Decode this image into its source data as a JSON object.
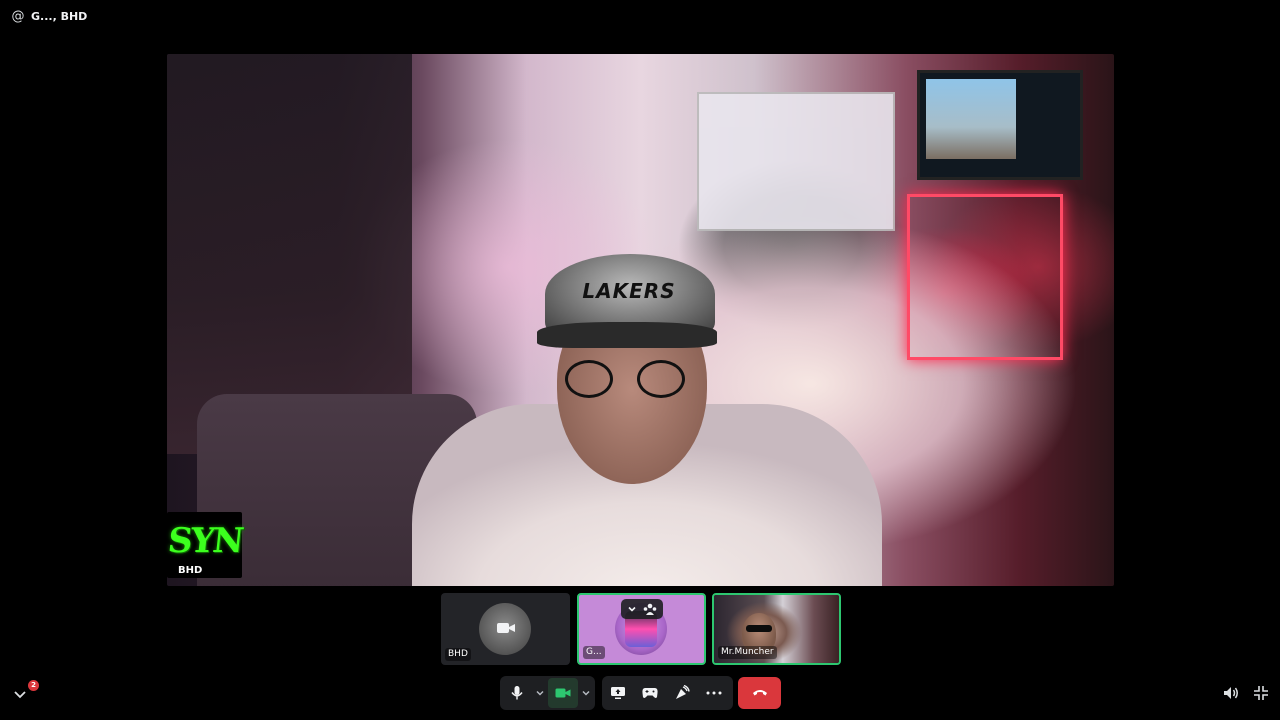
{
  "header": {
    "at_symbol": "@",
    "title": "G..., BHD"
  },
  "main_stream": {
    "overlay_text": "SYN",
    "participant_label": "BHD",
    "cap_text": "LAKERS"
  },
  "tiles": [
    {
      "label": "BHD",
      "icon": "camera-off-icon"
    },
    {
      "label": "G...",
      "icon": "avatar"
    },
    {
      "label": "Mr.Muncher",
      "icon": "video"
    }
  ],
  "controls": {
    "mic": "microphone-icon",
    "camera": "camera-icon",
    "share": "screen-share-icon",
    "activity": "gamepad-icon",
    "soundboard": "soundboard-icon",
    "more": "more-icon",
    "end": "end-call-icon"
  },
  "notifications": {
    "count": "2"
  },
  "colors": {
    "background": "#000000",
    "panel": "#1e1f22",
    "speaking_ring": "#2dc770",
    "end_call": "#da373c",
    "tile_g_bg": "#c58ad8"
  }
}
